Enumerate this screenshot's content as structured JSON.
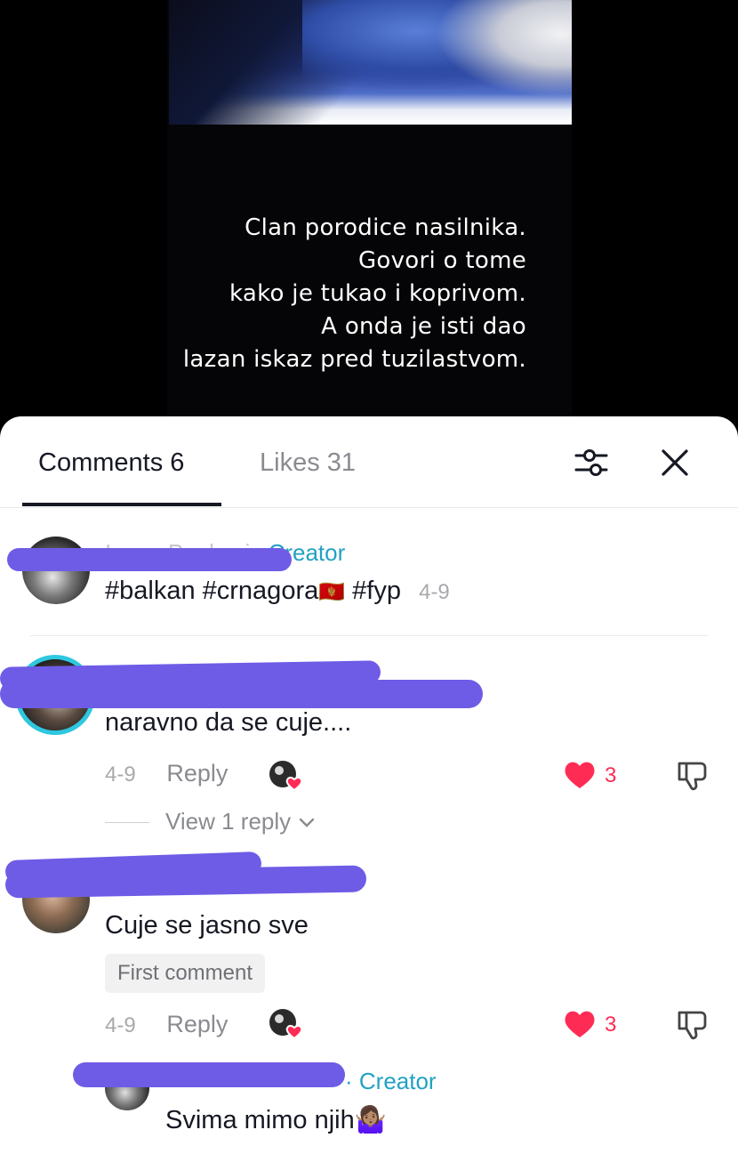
{
  "video": {
    "caption_lines": [
      "Clan porodice nasilnika.",
      "Govori o tome",
      "kako je tukao i koprivom.",
      "A onda je isti dao",
      "lazan iskaz pred tuzilastvom."
    ]
  },
  "sheet": {
    "tabs": {
      "comments": "Comments 6",
      "likes": "Likes 31"
    },
    "icons": {
      "filter": "filter-sliders-icon",
      "close": "close-icon"
    }
  },
  "comments": [
    {
      "creator_tag": "Creator",
      "text": "#balkan #crnagora",
      "flag": "🇲🇪",
      "text_after_flag": " #fyp",
      "date": "4-9"
    },
    {
      "text": "naravno da se cuje....",
      "date": "4-9",
      "reply_label": "Reply",
      "likes": "3",
      "view_replies": "View 1 reply"
    },
    {
      "text": "Cuje se jasno sve",
      "badge": "First comment",
      "date": "4-9",
      "reply_label": "Reply",
      "likes": "3"
    }
  ],
  "reply": {
    "creator_tag": "· Creator",
    "text": "Svima mimo njih🤷🏽‍♀️"
  },
  "colors": {
    "accent": "#fe2c55",
    "creator": "#22a1c4",
    "redaction": "#6e5ce6"
  }
}
